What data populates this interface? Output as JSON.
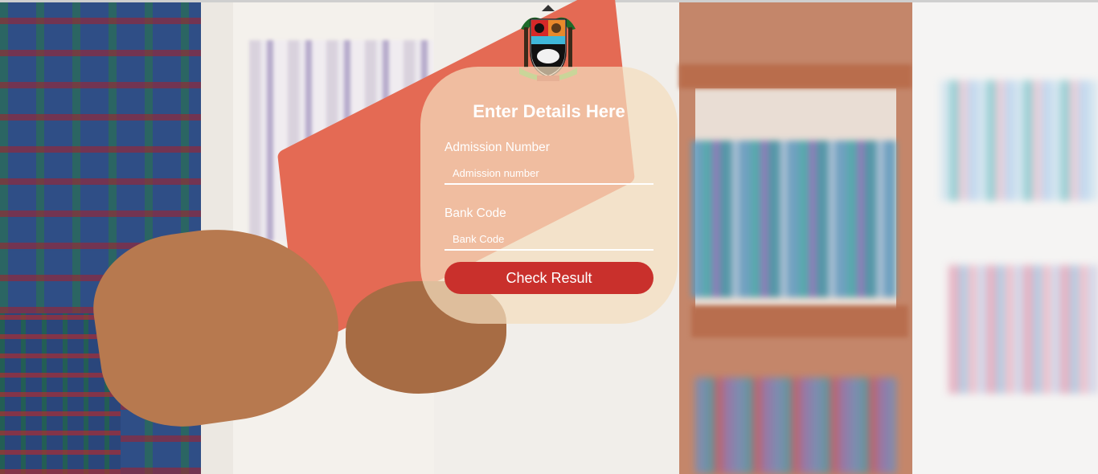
{
  "form": {
    "title": "Enter Details Here",
    "admission_label": "Admission Number",
    "admission_placeholder": "Admission number",
    "admission_value": "",
    "bank_label": "Bank Code",
    "bank_placeholder": "Bank Code",
    "bank_value": "",
    "submit_label": "Check Result"
  },
  "colors": {
    "button": "#c9302c",
    "card": "rgba(244,222,190,0.72)",
    "text": "#ffffff"
  },
  "logo": {
    "icon": "lagos-state-coat-of-arms"
  }
}
